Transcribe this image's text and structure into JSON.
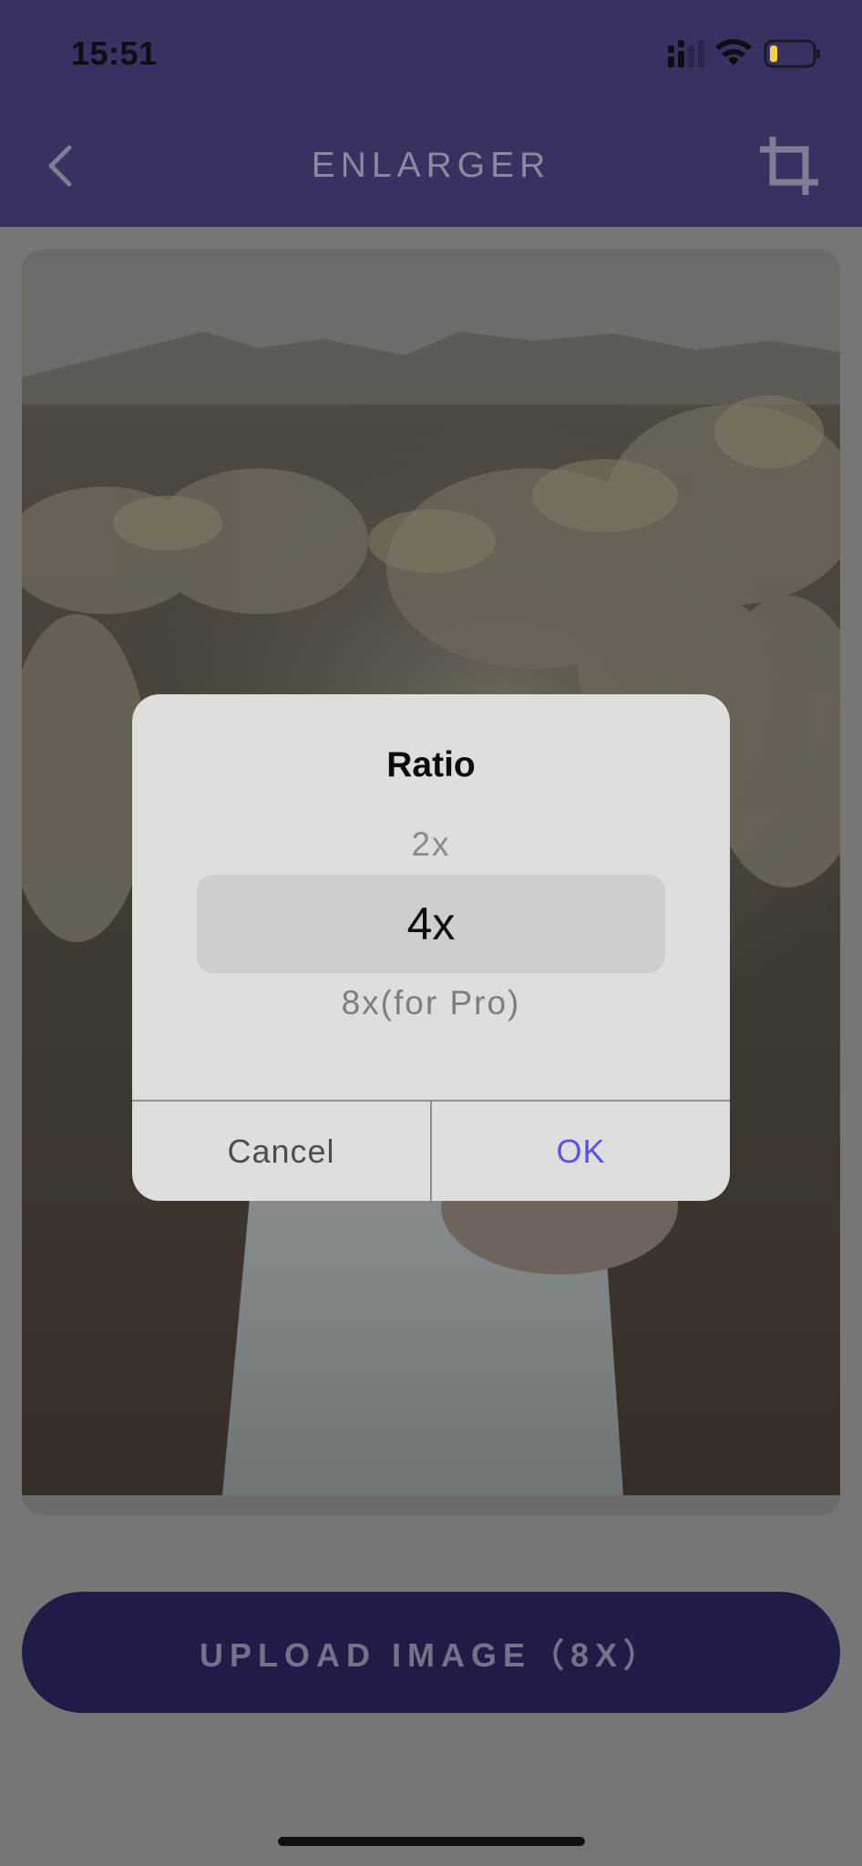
{
  "status_bar": {
    "time": "15:51",
    "icons": [
      "cellular-signal-icon",
      "wifi-icon",
      "battery-low-icon"
    ]
  },
  "header": {
    "title": "ENLARGER",
    "back_icon": "chevron-left-icon",
    "action_icon": "crop-icon",
    "background_color": "#363363"
  },
  "dialog": {
    "title": "Ratio",
    "options": [
      "2x",
      "4x",
      "8x(for Pro)"
    ],
    "selected": "4x",
    "cancel_label": "Cancel",
    "ok_label": "OK",
    "ok_color": "#5a4ff0"
  },
  "upload_button": {
    "label": "UPLOAD IMAGE（8X）",
    "background_color": "#1f1c48"
  }
}
